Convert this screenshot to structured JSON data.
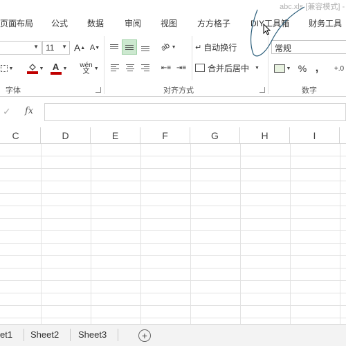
{
  "window": {
    "title": "abc.xls  [兼容模式] - E"
  },
  "tabs": [
    "页面布局",
    "公式",
    "数据",
    "审阅",
    "视图",
    "方方格子",
    "DIY工具箱",
    "财务工具"
  ],
  "font": {
    "size": "11",
    "grow_label": "A",
    "shrink_label": "A",
    "wen_label": "wén",
    "group_label": "字体"
  },
  "alignment": {
    "wrap_text": "自动换行",
    "merge_center": "合并后居中",
    "group_label": "对齐方式"
  },
  "number": {
    "format": "常规",
    "percent": "%",
    "comma": ",",
    "decimal": "+.0",
    "group_label": "数字"
  },
  "formula_bar": {
    "fx": "fx",
    "check": "✓",
    "value": ""
  },
  "columns": [
    "C",
    "D",
    "E",
    "F",
    "G",
    "H",
    "I"
  ],
  "sheets": [
    "et1",
    "Sheet2",
    "Sheet3"
  ],
  "colors": {
    "fill": "#c00000",
    "font": "#c00000",
    "active_align": "#cce8cf"
  }
}
